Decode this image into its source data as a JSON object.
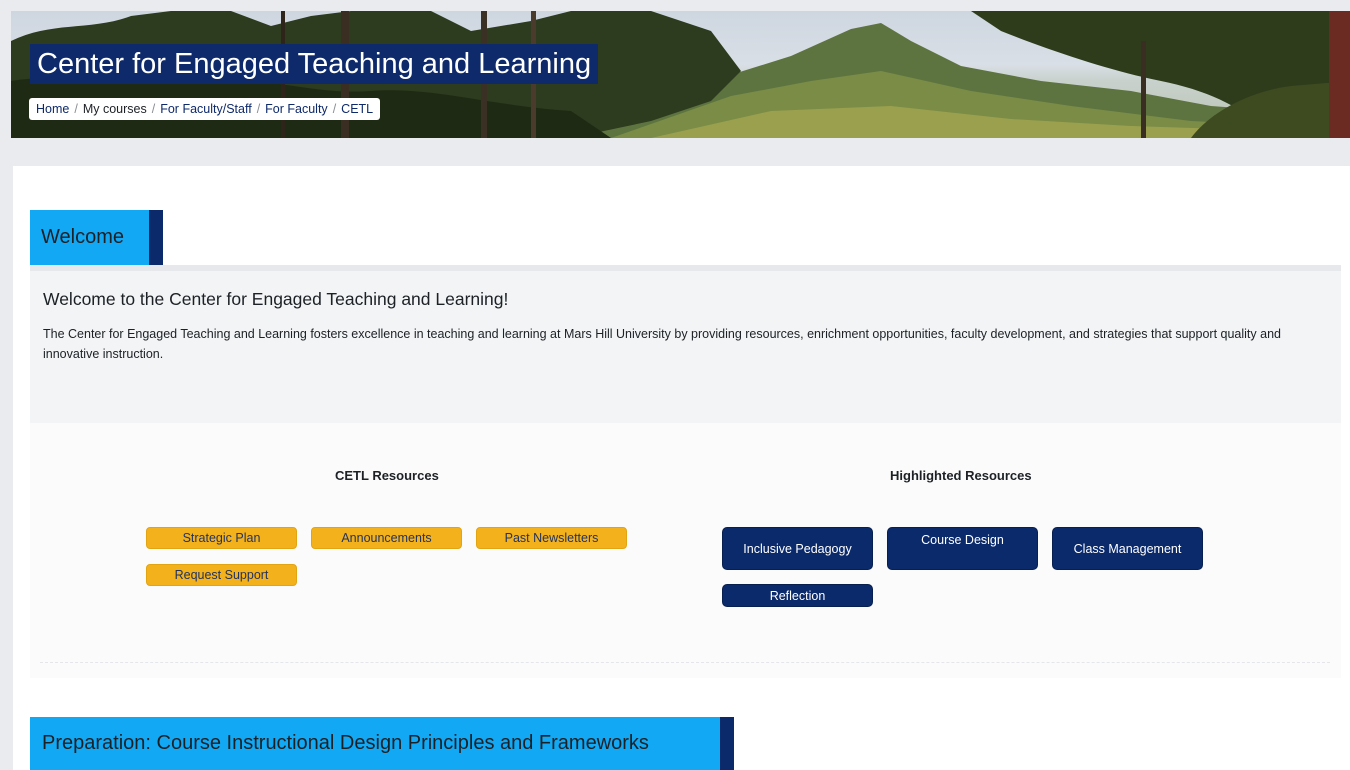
{
  "banner": {
    "title": "Center for Engaged Teaching and Learning",
    "breadcrumb": [
      "Home",
      "My courses",
      "For Faculty/Staff",
      "For Faculty",
      "CETL"
    ]
  },
  "welcome_section": {
    "header": "Welcome",
    "title": "Welcome to the Center for Engaged Teaching and Learning!",
    "body": "The Center for Engaged Teaching and Learning fosters excellence in teaching and learning at Mars Hill University by providing resources, enrichment opportunities, faculty development, and strategies that support quality and innovative instruction."
  },
  "cetl_resources": {
    "heading": "CETL Resources",
    "buttons": [
      "Strategic Plan",
      "Announcements",
      "Past Newsletters",
      "Request Support"
    ]
  },
  "highlighted_resources": {
    "heading": "Highlighted Resources",
    "buttons": [
      "Inclusive Pedagogy",
      "Course Design",
      "Class Management",
      "Reflection"
    ]
  },
  "preparation_section": {
    "header": "Preparation: Course Instructional Design Principles and Frameworks"
  },
  "colors": {
    "section_header": "#12a8f4",
    "navy": "#0b2a6b",
    "gold": "#f3b21b"
  }
}
